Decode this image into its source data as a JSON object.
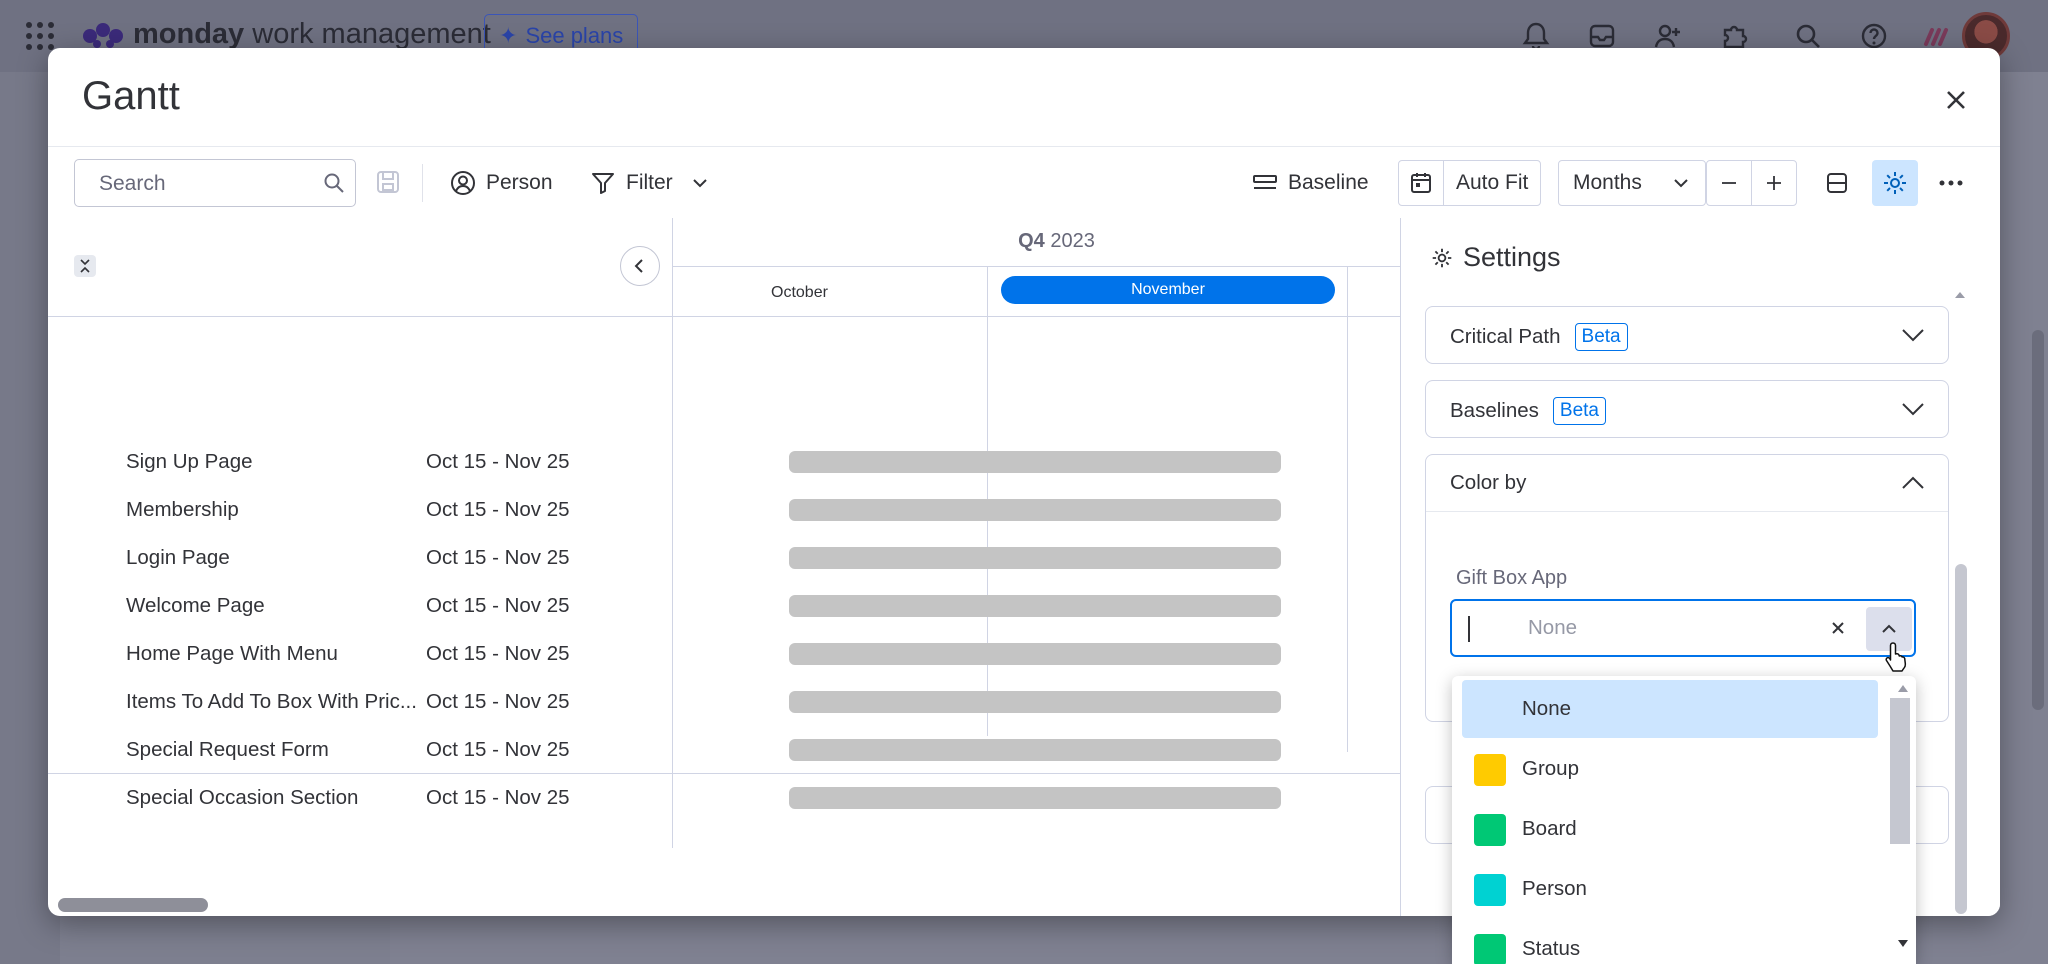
{
  "app": {
    "brand_bold": "monday",
    "brand_rest": " work management",
    "see_plans": "See plans"
  },
  "modal": {
    "title": "Gantt"
  },
  "toolbar": {
    "search_placeholder": "Search",
    "person_label": "Person",
    "filter_label": "Filter",
    "baseline_label": "Baseline",
    "autofit_label": "Auto Fit",
    "scale_value": "Months"
  },
  "timeline": {
    "quarter_bold": "Q4",
    "quarter_year": "2023",
    "months": [
      "October",
      "November"
    ],
    "active_month": "November"
  },
  "tasks": [
    {
      "name": "Sign Up Page",
      "dates": "Oct 15 - Nov 25"
    },
    {
      "name": "Membership",
      "dates": "Oct 15 - Nov 25"
    },
    {
      "name": "Login Page",
      "dates": "Oct 15 - Nov 25"
    },
    {
      "name": "Welcome Page",
      "dates": "Oct 15 - Nov 25"
    },
    {
      "name": "Home Page With Menu",
      "dates": "Oct 15 - Nov 25"
    },
    {
      "name": "Items To Add To Box With Pric...",
      "dates": "Oct 15 - Nov 25"
    },
    {
      "name": "Special Request Form",
      "dates": "Oct 15 - Nov 25"
    },
    {
      "name": "Special Occasion Section",
      "dates": "Oct 15 - Nov 25"
    }
  ],
  "settings": {
    "title": "Settings",
    "critical_path_label": "Critical Path",
    "baselines_label": "Baselines",
    "beta_label": "Beta",
    "color_by_label": "Color by",
    "board_name": "Gift Box App",
    "color_by_value": "None"
  },
  "color_options": [
    {
      "label": "None",
      "color": null,
      "selected": true
    },
    {
      "label": "Group",
      "color": "#ffcb00",
      "selected": false
    },
    {
      "label": "Board",
      "color": "#00c875",
      "selected": false
    },
    {
      "label": "Person",
      "color": "#00d2d2",
      "selected": false
    },
    {
      "label": "Status",
      "color": "#00c875",
      "selected": false
    }
  ],
  "colors": {
    "primary": "#0073ea",
    "bar": "#c4c4c4",
    "selected_bg": "#cce5ff"
  }
}
